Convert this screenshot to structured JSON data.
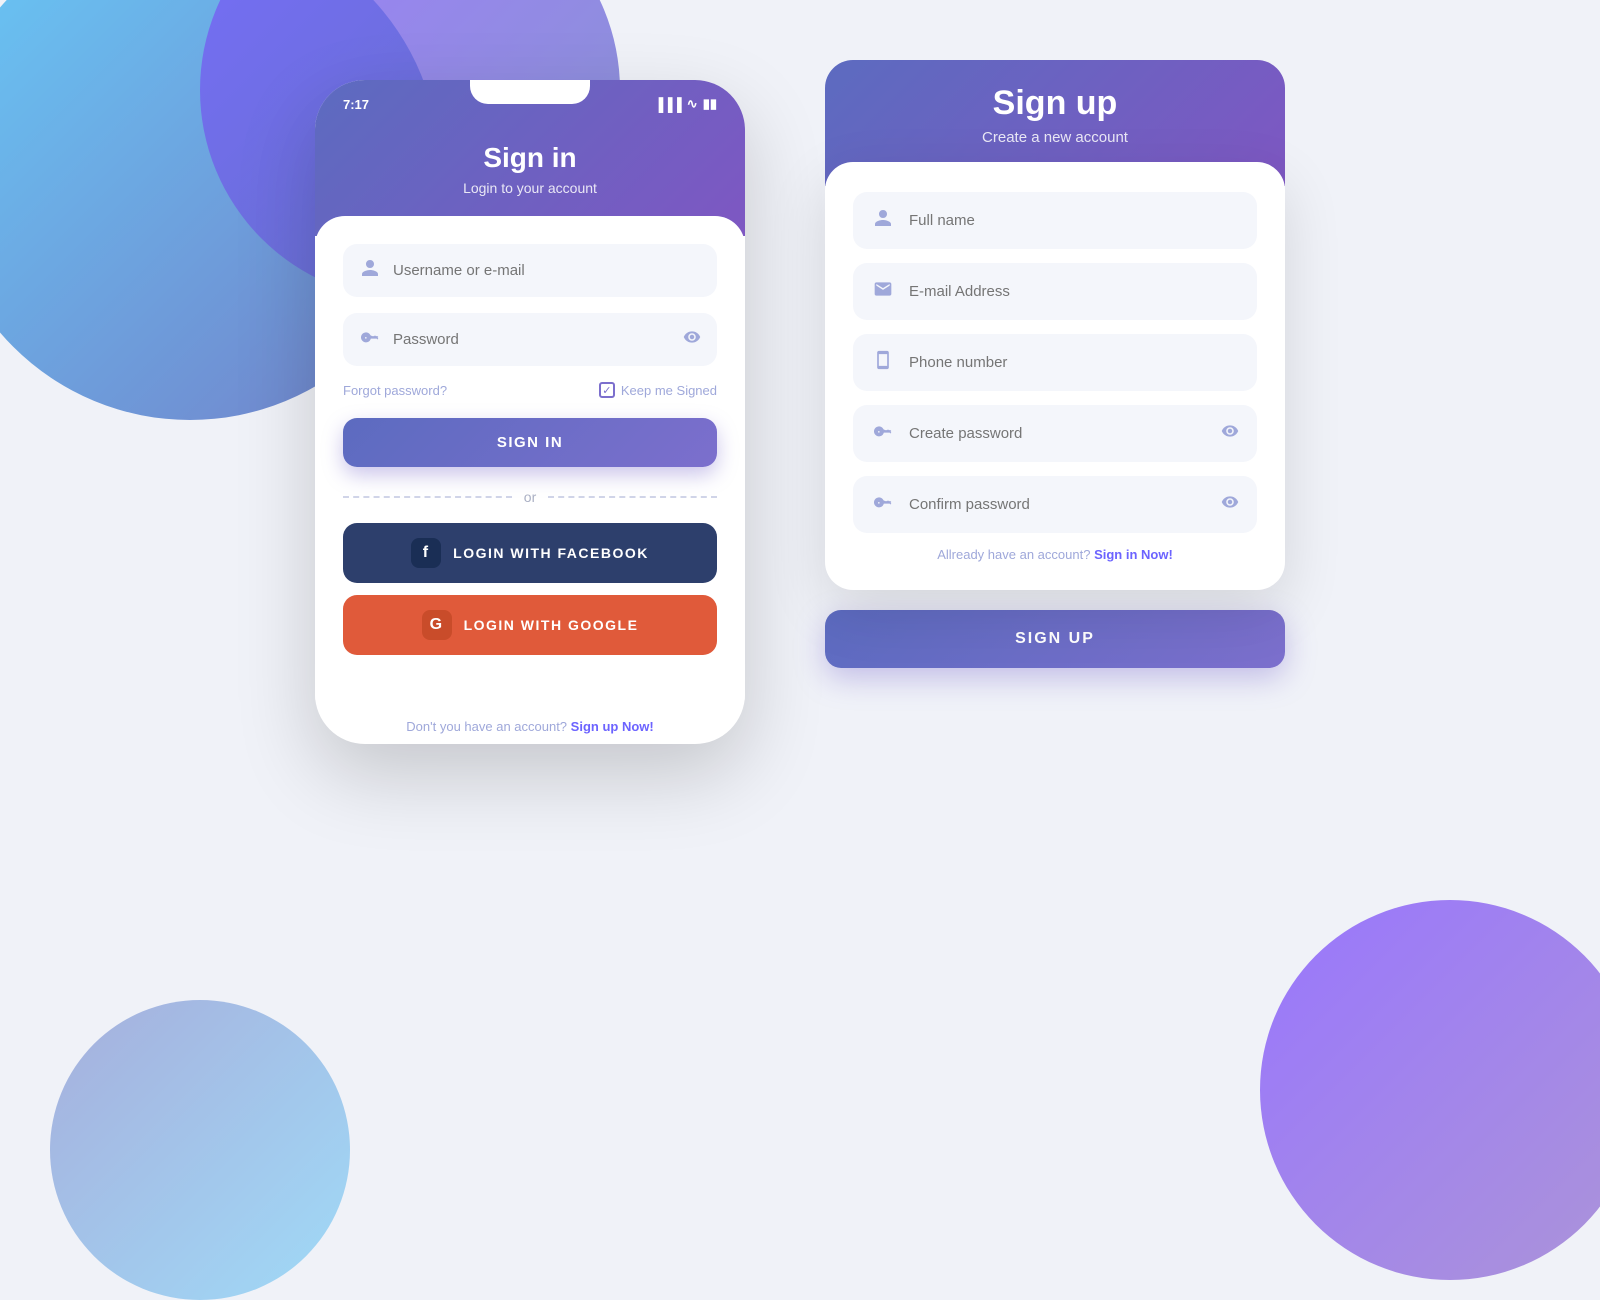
{
  "background": {
    "color": "#f0f2f8"
  },
  "signin": {
    "status_time": "7:17",
    "title": "Sign in",
    "subtitle": "Login to your account",
    "username_placeholder": "Username or e-mail",
    "password_placeholder": "Password",
    "forgot_password": "Forgot password?",
    "keep_signed": "Keep me Signed",
    "signin_button": "SIGN IN",
    "or_text": "or",
    "facebook_button": "LOGIN WITH FACEBOOK",
    "google_button": "LOGIN WITH GOOGLE",
    "footer_text": "Don't you have an account?",
    "footer_link": "Sign up Now!"
  },
  "signup": {
    "title": "Sign up",
    "subtitle": "Create a new account",
    "fullname_placeholder": "Full name",
    "email_placeholder": "E-mail Address",
    "phone_placeholder": "Phone number",
    "password_placeholder": "Create password",
    "confirm_placeholder": "Confirm password",
    "already_text": "Allready have an account?",
    "already_link": "Sign in Now!",
    "signup_button": "SIGN UP"
  },
  "icons": {
    "user": "👤",
    "email": "✉",
    "phone": "📱",
    "key": "🔑",
    "eye": "👁",
    "facebook_letter": "f",
    "google_letter": "G",
    "check": "✓"
  }
}
